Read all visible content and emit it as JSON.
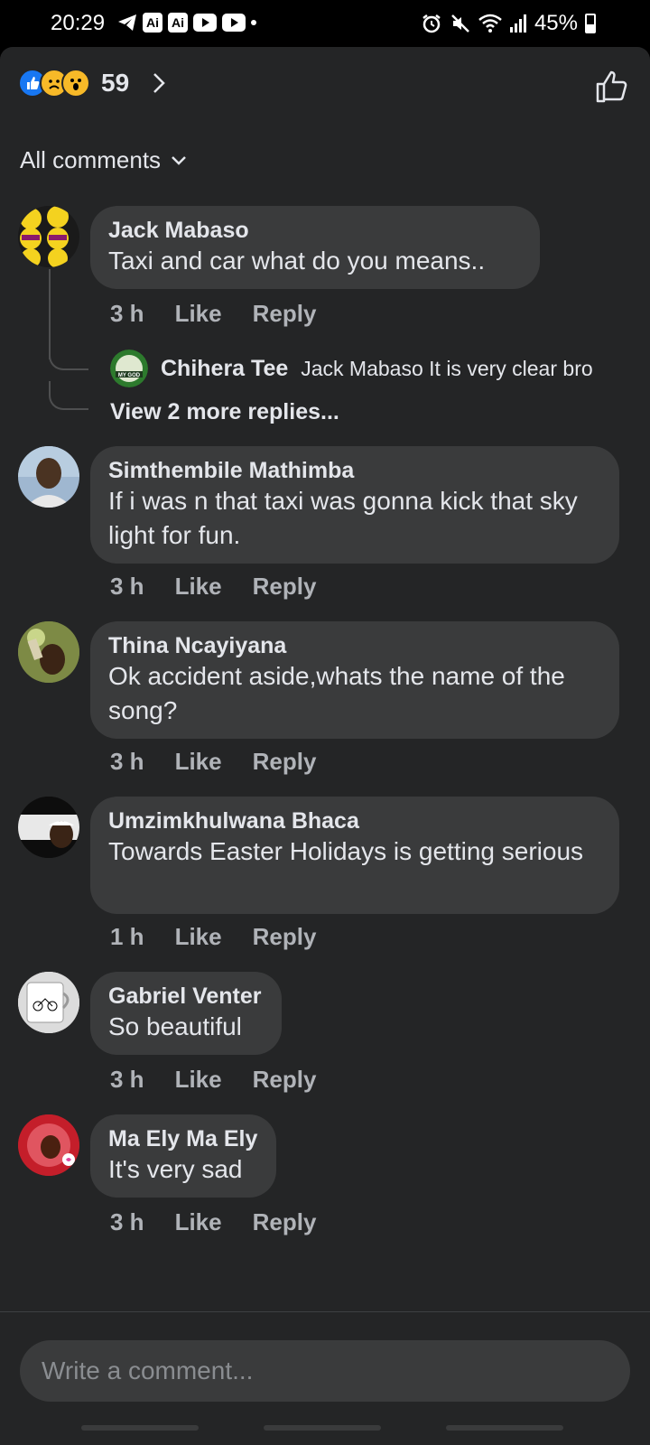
{
  "status_bar": {
    "time": "20:29",
    "box1": "Ai",
    "box2": "Ai",
    "battery": "45%"
  },
  "header": {
    "reaction_count": "59"
  },
  "sort": {
    "label": "All comments"
  },
  "comments": [
    {
      "author": "Jack Mabaso",
      "text": "Taxi and car what  do you means..",
      "time": "3 h",
      "like": "Like",
      "reply": "Reply"
    },
    {
      "author": "Simthembile Mathimba",
      "text": "If i was n that taxi was gonna kick that sky light for fun.",
      "time": "3 h",
      "like": "Like",
      "reply": "Reply"
    },
    {
      "author": "Thina Ncayiyana",
      "text": "Ok accident aside,whats the name of the song?",
      "time": "3 h",
      "like": "Like",
      "reply": "Reply"
    },
    {
      "author": "Umzimkhulwana Bhaca",
      "text": "Towards Easter Holidays is getting serious",
      "time": "1 h",
      "like": "Like",
      "reply": "Reply"
    },
    {
      "author": "Gabriel Venter",
      "text": "So beautiful",
      "time": "3 h",
      "like": "Like",
      "reply": "Reply"
    },
    {
      "author": "Ma Ely Ma Ely",
      "text": "It's very sad",
      "time": "3 h",
      "like": "Like",
      "reply": "Reply"
    }
  ],
  "reply": {
    "author": "Chihera Tee",
    "text": "Jack Mabaso It is very clear bro",
    "avatar_text": "MY GOD"
  },
  "more_replies": "View 2 more replies...",
  "composer": {
    "placeholder": "Write a comment..."
  },
  "colors": {
    "background": "#242526",
    "bubble": "#3a3b3c",
    "like_blue": "#1877f2"
  }
}
